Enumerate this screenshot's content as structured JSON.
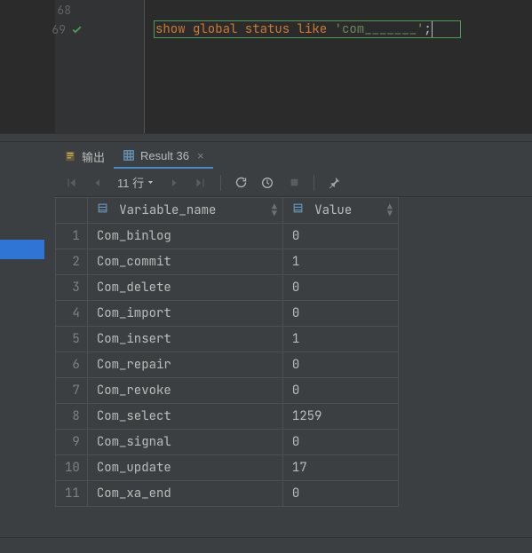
{
  "editor": {
    "lines": [
      {
        "num": "68",
        "mark": ""
      },
      {
        "num": "69",
        "mark": "check"
      }
    ],
    "sql_kw": "show global status like ",
    "sql_str": "'com_______'",
    "sql_tail": ";"
  },
  "tabs": {
    "output_label": "输出",
    "result_label": "Result 36"
  },
  "toolbar": {
    "rows_label": "11 行"
  },
  "columns": {
    "variable": "Variable_name",
    "value": "Value"
  },
  "rows": [
    {
      "n": "1",
      "variable": "Com_binlog",
      "value": "0"
    },
    {
      "n": "2",
      "variable": "Com_commit",
      "value": "1"
    },
    {
      "n": "3",
      "variable": "Com_delete",
      "value": "0"
    },
    {
      "n": "4",
      "variable": "Com_import",
      "value": "0"
    },
    {
      "n": "5",
      "variable": "Com_insert",
      "value": "1"
    },
    {
      "n": "6",
      "variable": "Com_repair",
      "value": "0"
    },
    {
      "n": "7",
      "variable": "Com_revoke",
      "value": "0"
    },
    {
      "n": "8",
      "variable": "Com_select",
      "value": "1259"
    },
    {
      "n": "9",
      "variable": "Com_signal",
      "value": "0"
    },
    {
      "n": "10",
      "variable": "Com_update",
      "value": "17"
    },
    {
      "n": "11",
      "variable": "Com_xa_end",
      "value": "0"
    }
  ]
}
